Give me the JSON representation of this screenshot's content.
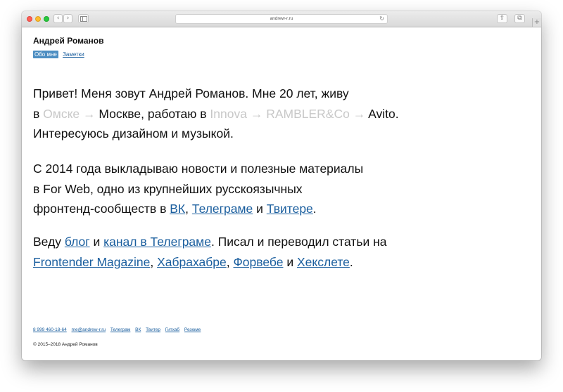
{
  "browser": {
    "url": "andrew-r.ru",
    "back_glyph": "‹",
    "forward_glyph": "›",
    "reload_glyph": "↻",
    "share_glyph": "⇪",
    "tabs_glyph": "⧉",
    "new_tab_glyph": "+"
  },
  "header": {
    "title": "Андрей Романов",
    "nav": [
      {
        "label": "Обо мне",
        "active": true
      },
      {
        "label": "Заметки",
        "active": false
      }
    ]
  },
  "intro": {
    "p1_start": "Привет! Меня зовут Андрей Романов. Мне 20 лет, живу",
    "in": "в ",
    "city_old": "Омске",
    "arrow": " → ",
    "city_now": "Москве",
    "work": ", работаю в ",
    "job1": "Innova",
    "job2": "RAMBLER&Co",
    "job3": "Avito",
    "p1_end_dot": ".",
    "p1_line3": "Интересуюсь дизайном и музыкой."
  },
  "forweb": {
    "line1": "С 2014 года выкладываю новости и полезные материалы",
    "line2": "в For Web, одно из крупнейших русскоязычных",
    "line3_start": "фронтенд-сообществ в ",
    "vk": "ВК",
    "comma": ", ",
    "telegram": "Телеграме",
    "and": " и ",
    "twitter": "Твитере",
    "dot": "."
  },
  "blog": {
    "lead": "Веду ",
    "blog": "блог",
    "and": " и ",
    "channel": "канал в Телеграме",
    "mid": ". Писал и переводил статьи на",
    "frontender": "Frontender Magazine",
    "comma": ", ",
    "habr": "Хабрахабре",
    "forweb": "Форвебе",
    "and2": " и ",
    "hexlet": "Хекслете",
    "dot": "."
  },
  "footer": {
    "links": [
      "8 999 460-18-64",
      "me@andrew-r.ru",
      "Телеграм",
      "ВК",
      "Твитер",
      "Гитхаб",
      "Резюме"
    ],
    "copyright": "© 2015–2018 Андрей Романов"
  },
  "colors": {
    "link": "#1a5e9e",
    "nav_active_bg": "#4d8ec2",
    "faded": "#c8c8c8",
    "traffic_red": "#fe5f57",
    "traffic_yellow": "#febc2e",
    "traffic_green": "#28c840"
  }
}
